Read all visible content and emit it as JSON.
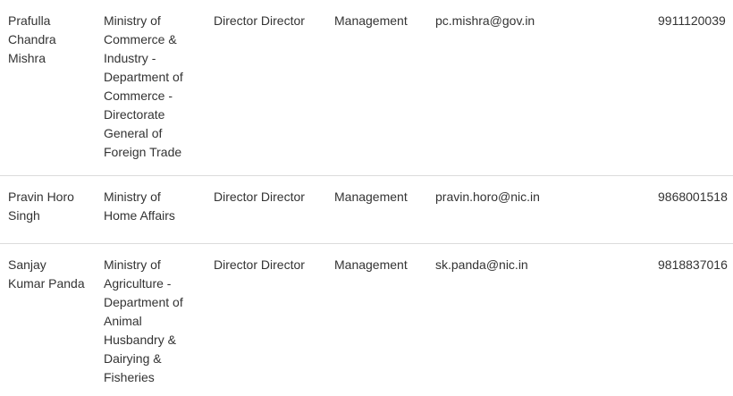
{
  "rows": [
    {
      "name": [
        "Prafulla",
        "Chandra",
        "Mishra"
      ],
      "ministry": [
        "Ministry of",
        "Commerce &",
        "Industry -",
        "Department of",
        "Commerce -",
        "Directorate",
        "General of",
        "Foreign Trade"
      ],
      "designation": "Director Director",
      "department": "Management",
      "email": "pc.mishra@gov.in",
      "phone": "9911120039"
    },
    {
      "name": [
        "Pravin Horo",
        "Singh"
      ],
      "ministry": [
        "Ministry of",
        "Home Affairs"
      ],
      "designation": "Director Director",
      "department": "Management",
      "email": "pravin.horo@nic.in",
      "phone": "9868001518"
    },
    {
      "name": [
        "Sanjay",
        "Kumar Panda"
      ],
      "ministry": [
        "Ministry of",
        "Agriculture -",
        "Department of",
        "Animal",
        "Husbandry &",
        "Dairying &",
        "Fisheries"
      ],
      "designation": "Director Director",
      "department": "Management",
      "email": "sk.panda@nic.in",
      "phone": "9818837016"
    }
  ]
}
